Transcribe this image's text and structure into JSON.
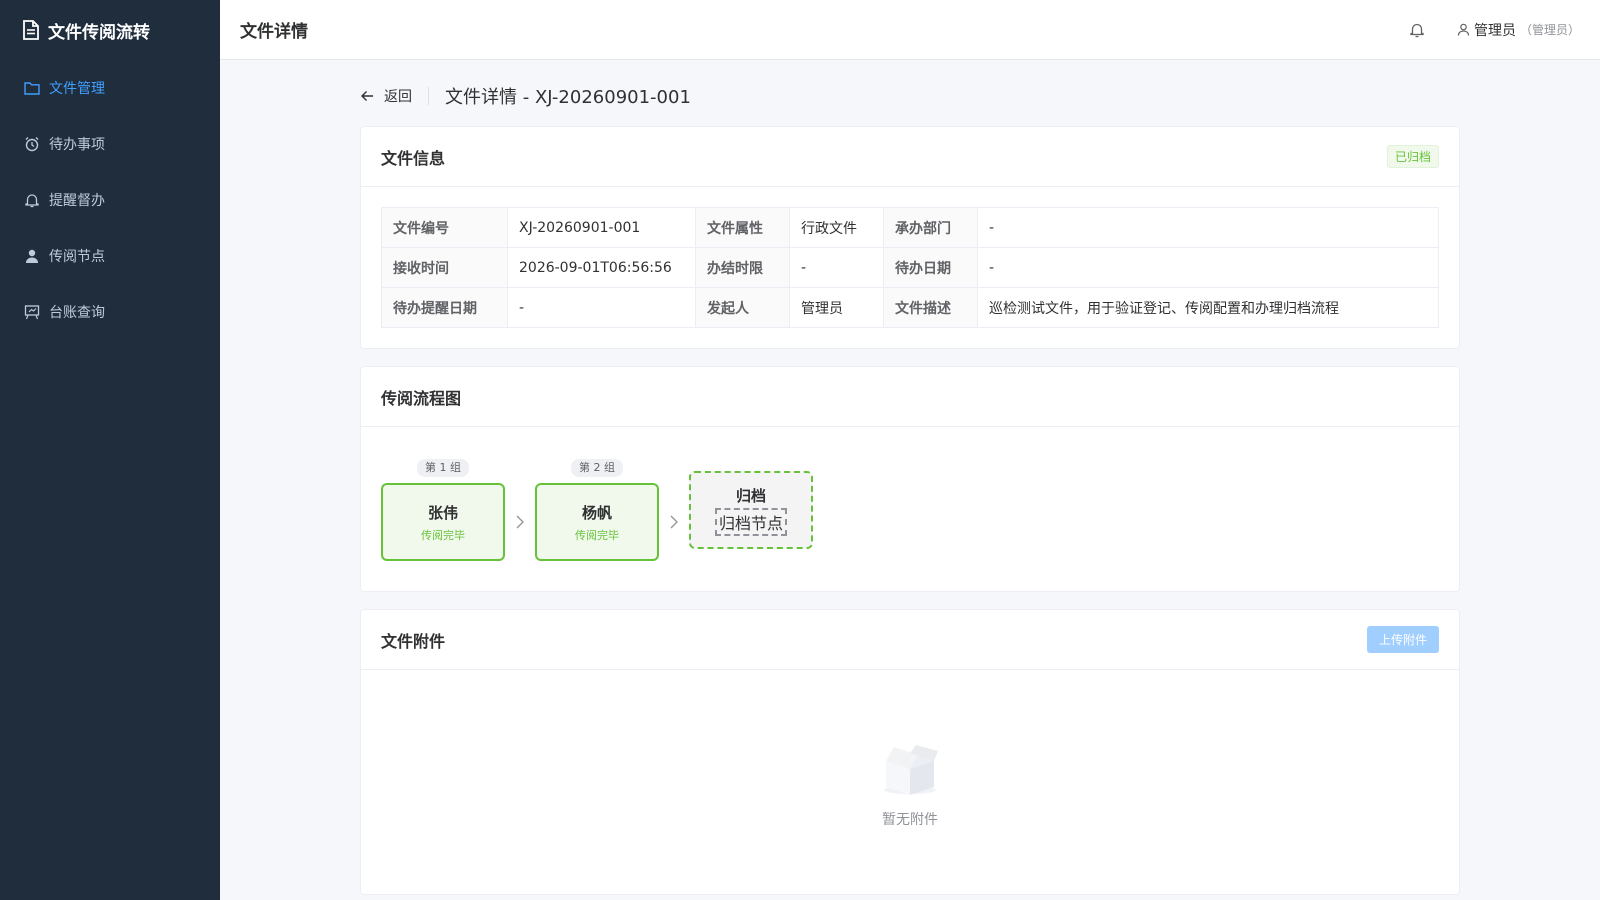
{
  "app": {
    "title": "文件传阅流转"
  },
  "sidebar": {
    "items": [
      {
        "label": "文件管理",
        "icon": "folder-icon",
        "active": true
      },
      {
        "label": "待办事项",
        "icon": "alarm-clock-icon",
        "active": false
      },
      {
        "label": "提醒督办",
        "icon": "bell-icon",
        "active": false
      },
      {
        "label": "传阅节点",
        "icon": "user-icon",
        "active": false
      },
      {
        "label": "台账查询",
        "icon": "presentation-icon",
        "active": false
      }
    ]
  },
  "header": {
    "title": "文件详情",
    "user_name": "管理员",
    "user_role": "（管理员）"
  },
  "page": {
    "back_label": "返回",
    "title": "文件详情 - XJ-20260901-001"
  },
  "file_info": {
    "title": "文件信息",
    "status_tag": "已归档",
    "rows": [
      [
        {
          "label": "文件编号",
          "value": "XJ-20260901-001"
        },
        {
          "label": "文件属性",
          "value": "行政文件"
        },
        {
          "label": "承办部门",
          "value": "-"
        }
      ],
      [
        {
          "label": "接收时间",
          "value": "2026-09-01T06:56:56"
        },
        {
          "label": "办结时限",
          "value": "-"
        },
        {
          "label": "待办日期",
          "value": "-"
        }
      ],
      [
        {
          "label": "待办提醒日期",
          "value": "-"
        },
        {
          "label": "发起人",
          "value": "管理员"
        },
        {
          "label": "文件描述",
          "value": "巡检测试文件，用于验证登记、传阅配置和办理归档流程"
        }
      ]
    ]
  },
  "flow": {
    "title": "传阅流程图",
    "nodes": [
      {
        "group": "第 1 组",
        "name": "张伟",
        "status": "传阅完毕"
      },
      {
        "group": "第 2 组",
        "name": "杨帆",
        "status": "传阅完毕"
      }
    ],
    "archive": {
      "name": "归档",
      "sub": "归档节点"
    }
  },
  "attachments": {
    "title": "文件附件",
    "upload_label": "上传附件",
    "empty_text": "暂无附件"
  },
  "colors": {
    "sidebar_bg": "#1f2d3d",
    "accent": "#409eff",
    "success": "#67c23a"
  }
}
